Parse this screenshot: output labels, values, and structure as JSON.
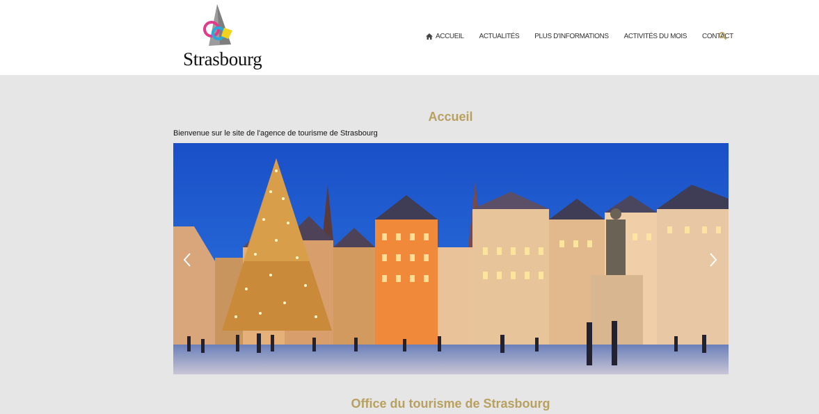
{
  "brand": {
    "logo_text": "Strasbourg"
  },
  "nav": {
    "items": [
      {
        "label": "ACCUEIL",
        "icon": "home-icon"
      },
      {
        "label": "ACTUALITÉS"
      },
      {
        "label": "PLUS D'INFORMATIONS"
      },
      {
        "label": "ACTIVITÉS DU MOIS"
      },
      {
        "label": "CONTACT"
      }
    ],
    "search_icon": "search-icon"
  },
  "main": {
    "title": "Accueil",
    "intro": "Bienvenue sur le site de l'agence de tourisme de Strasbourg",
    "section_title": "Office du tourisme de Strasbourg"
  },
  "colors": {
    "accent": "#b8a060",
    "background": "#e6e6e6",
    "header_bg": "#ffffff",
    "sky": "#1f5fd0"
  }
}
